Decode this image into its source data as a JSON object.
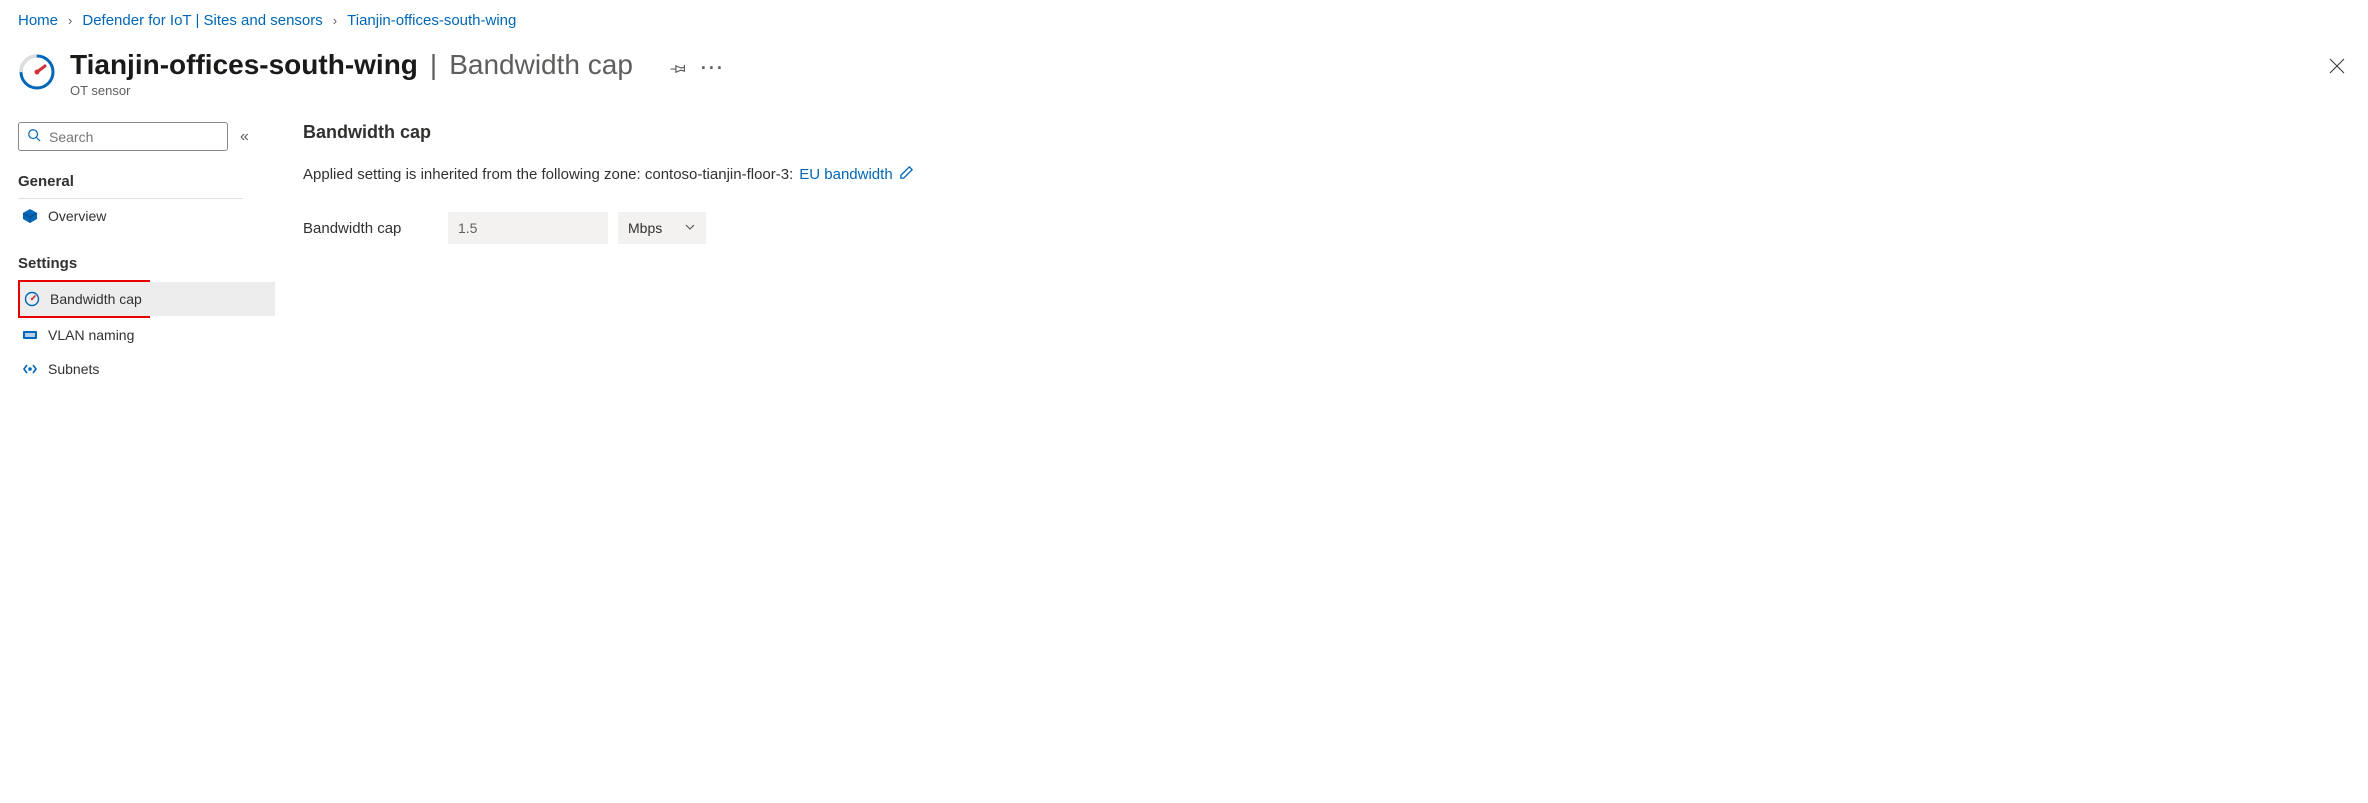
{
  "breadcrumb": {
    "home": "Home",
    "defender": "Defender for IoT | Sites and sensors",
    "sensor": "Tianjin-offices-south-wing"
  },
  "header": {
    "title": "Tianjin-offices-south-wing",
    "section": "Bandwidth cap",
    "subtitle": "OT sensor"
  },
  "sidebar": {
    "search_placeholder": "Search",
    "sections": {
      "general": "General",
      "settings": "Settings"
    },
    "items": {
      "overview": "Overview",
      "bandwidth": "Bandwidth cap",
      "vlan": "VLAN naming",
      "subnets": "Subnets"
    }
  },
  "main": {
    "heading": "Bandwidth cap",
    "info_prefix": "Applied setting is inherited from the following zone: contoso-tianjin-floor-3:",
    "info_link": "EU bandwidth",
    "form": {
      "label": "Bandwidth cap",
      "value": "1.5",
      "unit": "Mbps"
    }
  }
}
